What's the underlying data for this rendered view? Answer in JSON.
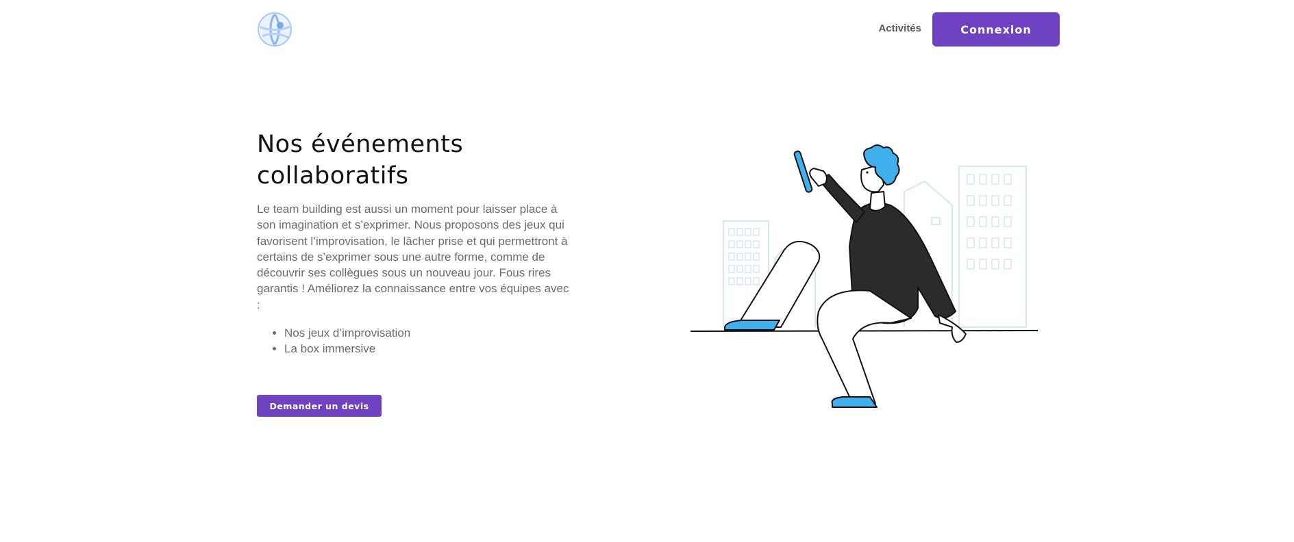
{
  "header": {
    "logo_icon": "globe-logo-icon",
    "nav_activities": "Activités",
    "login_label": "Connexion"
  },
  "hero": {
    "title_line1": "Nos événements",
    "title_line2": "collaboratifs",
    "description": "Le team building est aussi un moment pour laisser place à son imagination et s’exprimer. Nous proposons des jeux qui favorisent l’improvisation, le lâcher prise et qui permettront à certains de s’exprimer sous une autre forme, comme de découvrir ses collègues sous un nouveau jour. Fous rires garantis ! Améliorez la connaissance entre vos équipes avec :",
    "list": [
      "Nos jeux d’improvisation",
      "La box immersive"
    ],
    "cta_label": "Demander un devis"
  },
  "illustration": {
    "icon": "person-with-phone-illustration"
  },
  "colors": {
    "accent": "#6f42c1",
    "illustration_blue": "#3fb0ec",
    "sweater": "#2b2b2b"
  }
}
